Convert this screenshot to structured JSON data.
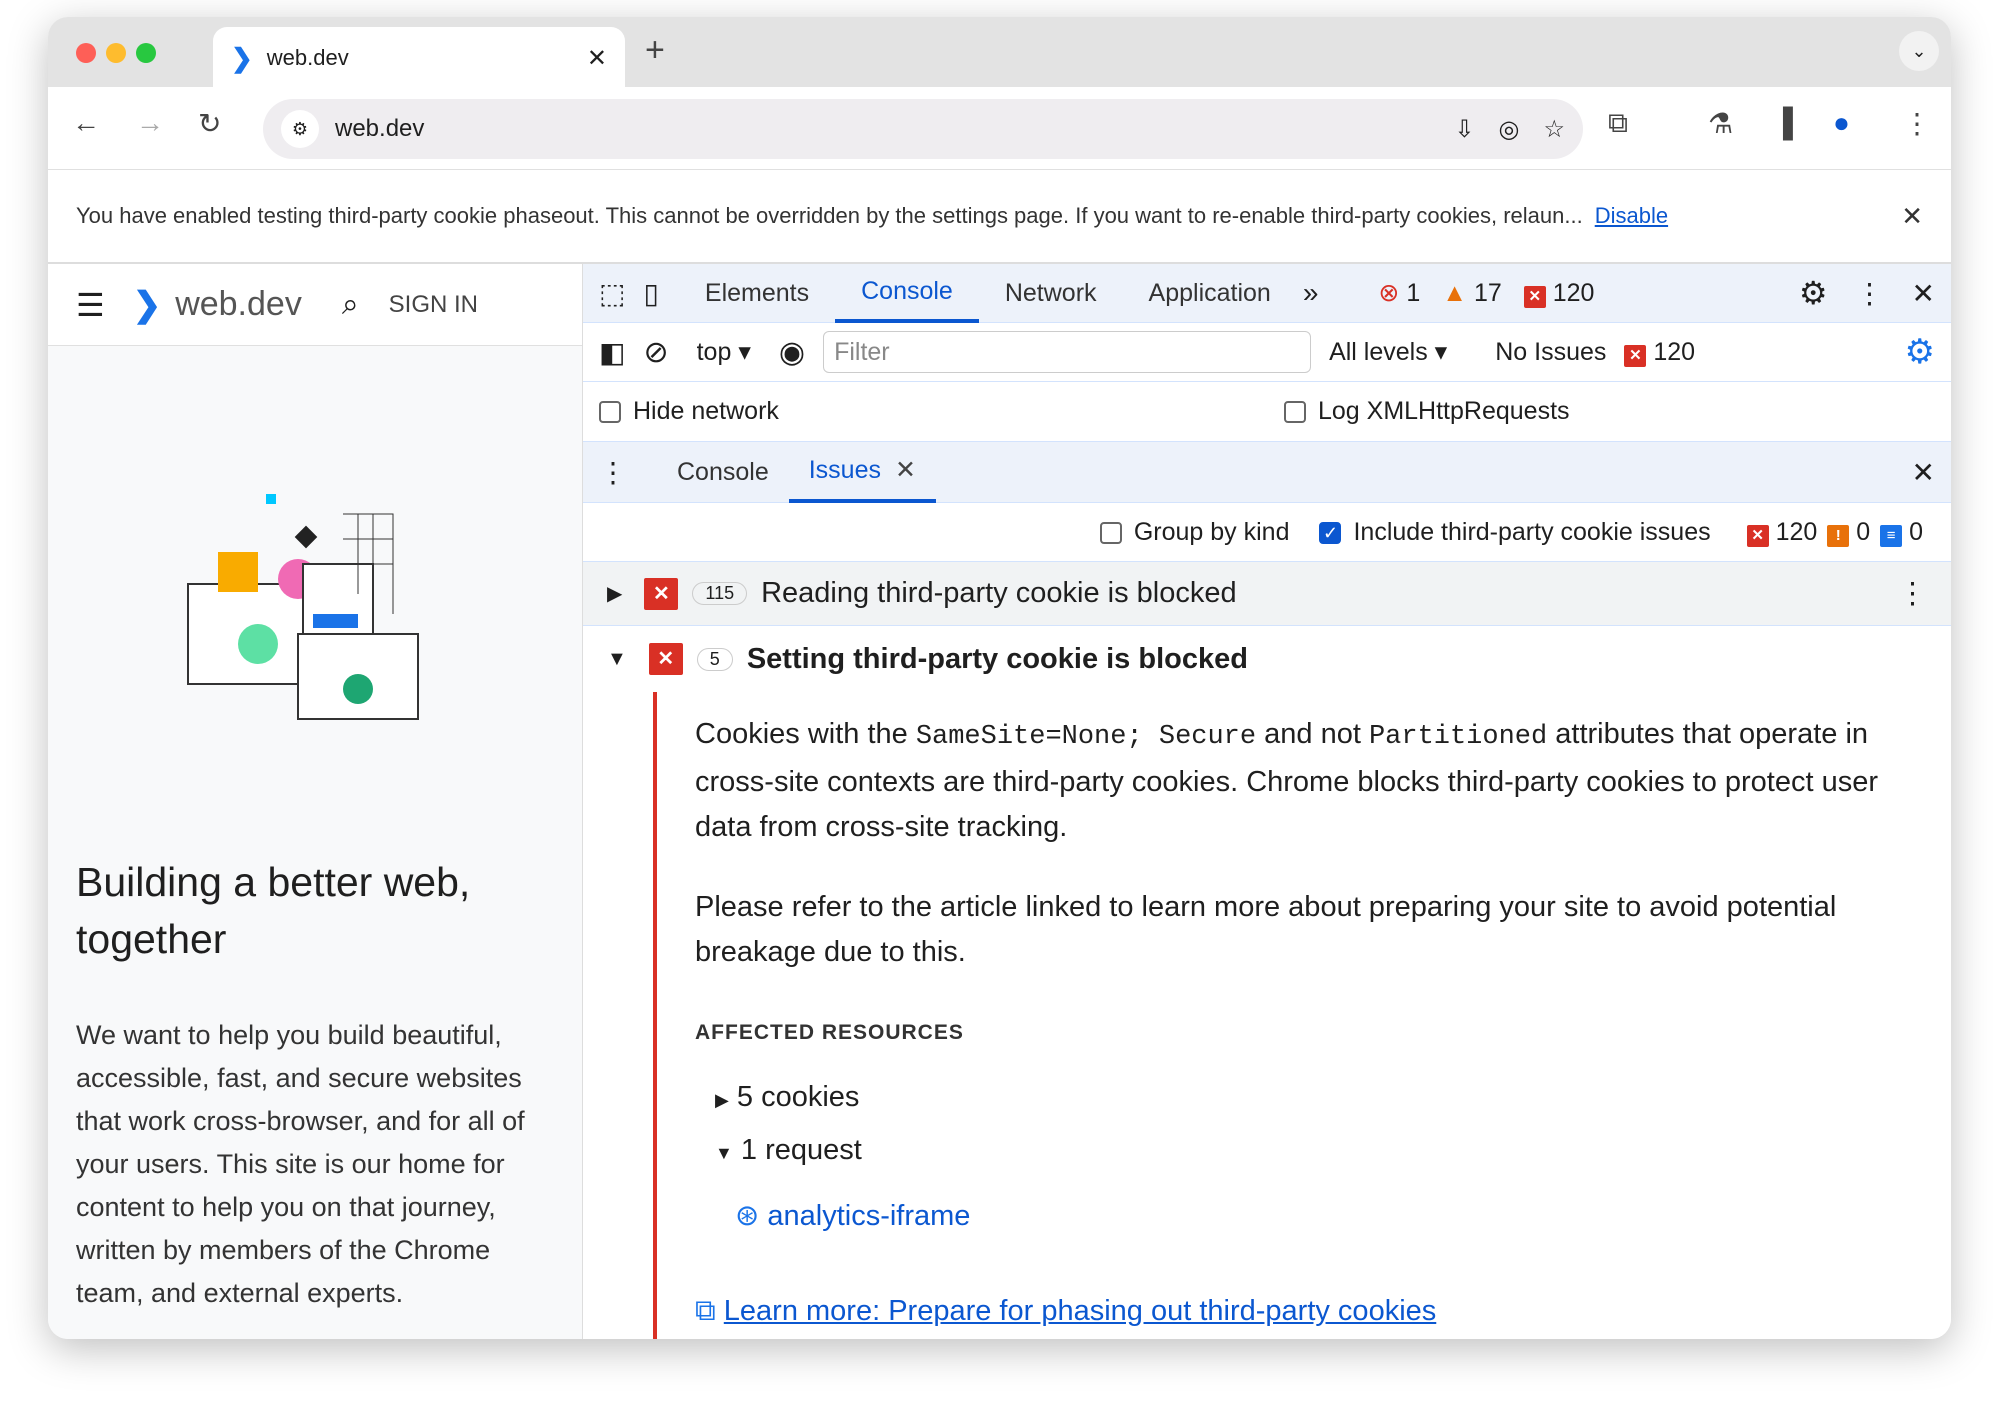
{
  "browser": {
    "tab_title": "web.dev",
    "url": "web.dev",
    "new_tab": "+"
  },
  "banner": {
    "text": "You have enabled testing third-party cookie phaseout. This cannot be overridden by the settings page. If you want to re-enable third-party cookies, relaun...",
    "link": "Disable"
  },
  "site": {
    "logo": "web.dev",
    "sign_in": "SIGN IN",
    "headline": "Building a better web, together",
    "paragraph": "We want to help you build beautiful, accessible, fast, and secure websites that work cross-browser, and for all of your users. This site is our home for content to help you on that journey, written by members of the Chrome team, and external experts."
  },
  "devtools": {
    "tabs": [
      "Elements",
      "Console",
      "Network",
      "Application"
    ],
    "active_tab": "Console",
    "counts": {
      "errors": "1",
      "warnings": "17",
      "issues": "120"
    },
    "console_bar": {
      "context": "top",
      "filter_placeholder": "Filter",
      "levels": "All levels",
      "no_issues": "No Issues",
      "issues": "120"
    },
    "options": {
      "hide_network": "Hide network",
      "log_xhr": "Log XMLHttpRequests"
    },
    "drawer_tabs": [
      "Console",
      "Issues"
    ],
    "issues_bar": {
      "group_by_kind": "Group by kind",
      "include_third_party": "Include third-party cookie issues",
      "errors": "120",
      "warnings": "0",
      "info": "0"
    },
    "issues": [
      {
        "count": "115",
        "title": "Reading third-party cookie is blocked",
        "expanded": false
      },
      {
        "count": "5",
        "title": "Setting third-party cookie is blocked",
        "expanded": true,
        "p1a": "Cookies with the ",
        "code1": "SameSite=None; Secure",
        "p1b": " and not ",
        "code2": "Partitioned",
        "p1c": " attributes that operate in cross-site contexts are third-party cookies. Chrome blocks third-party cookies to protect user data from cross-site tracking.",
        "p2": "Please refer to the article linked to learn more about preparing your site to avoid potential breakage due to this.",
        "affected_heading": "AFFECTED RESOURCES",
        "cookies": "5 cookies",
        "requests": "1 request",
        "request_link": "analytics-iframe",
        "learn_more": "Learn more: Prepare for phasing out third-party cookies"
      }
    ]
  }
}
